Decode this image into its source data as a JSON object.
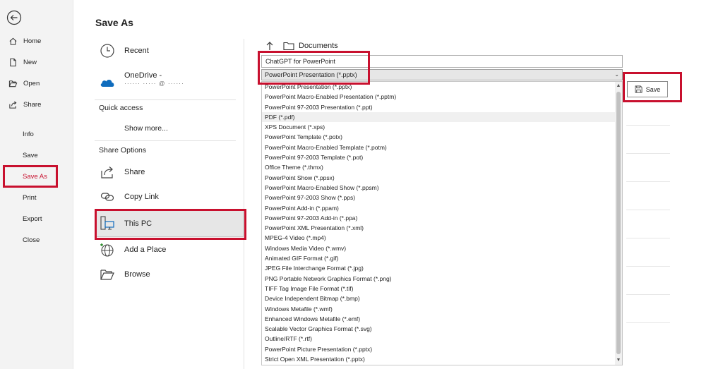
{
  "nav": {
    "items": [
      {
        "label": "Home",
        "icon": "home-icon"
      },
      {
        "label": "New",
        "icon": "new-file-icon"
      },
      {
        "label": "Open",
        "icon": "open-folder-icon"
      },
      {
        "label": "Share",
        "icon": "share-icon"
      },
      {
        "label": "Info"
      },
      {
        "label": "Save"
      },
      {
        "label": "Save As",
        "selected": true
      },
      {
        "label": "Print"
      },
      {
        "label": "Export"
      },
      {
        "label": "Close"
      }
    ]
  },
  "page_title": "Save As",
  "locations": {
    "recent": "Recent",
    "onedrive": "OneDrive -",
    "onedrive_account": "······ ····· @ ······",
    "quick_access": "Quick access",
    "show_more": "Show more...",
    "share_options": "Share Options",
    "share": "Share",
    "copy_link": "Copy Link",
    "this_pc": "This PC",
    "add_a_place": "Add a Place",
    "browse": "Browse"
  },
  "breadcrumb": {
    "folder": "Documents"
  },
  "file": {
    "name": "ChatGPT for PowerPoint",
    "type_selected": "PowerPoint Presentation (*.pptx)"
  },
  "save_button": "Save",
  "file_types": [
    "PowerPoint Presentation (*.pptx)",
    "PowerPoint Macro-Enabled Presentation (*.pptm)",
    "PowerPoint 97-2003 Presentation (*.ppt)",
    "PDF (*.pdf)",
    "XPS Document (*.xps)",
    "PowerPoint Template (*.potx)",
    "PowerPoint Macro-Enabled Template (*.potm)",
    "PowerPoint 97-2003 Template (*.pot)",
    "Office Theme (*.thmx)",
    "PowerPoint Show (*.ppsx)",
    "PowerPoint Macro-Enabled Show (*.ppsm)",
    "PowerPoint 97-2003 Show (*.pps)",
    "PowerPoint Add-in (*.ppam)",
    "PowerPoint 97-2003 Add-in (*.ppa)",
    "PowerPoint XML Presentation (*.xml)",
    "MPEG-4 Video (*.mp4)",
    "Windows Media Video (*.wmv)",
    "Animated GIF Format (*.gif)",
    "JPEG File Interchange Format (*.jpg)",
    "PNG Portable Network Graphics Format (*.png)",
    "TIFF Tag Image File Format (*.tif)",
    "Device Independent Bitmap (*.bmp)",
    "Windows Metafile (*.wmf)",
    "Enhanced Windows Metafile (*.emf)",
    "Scalable Vector Graphics Format (*.svg)",
    "Outline/RTF (*.rtf)",
    "PowerPoint Picture Presentation (*.pptx)",
    "Strict Open XML Presentation (*.pptx)"
  ],
  "highlighted_type_index": 3,
  "colors": {
    "highlight_red": "#c8102e",
    "onedrive_blue": "#0f6cbd"
  }
}
